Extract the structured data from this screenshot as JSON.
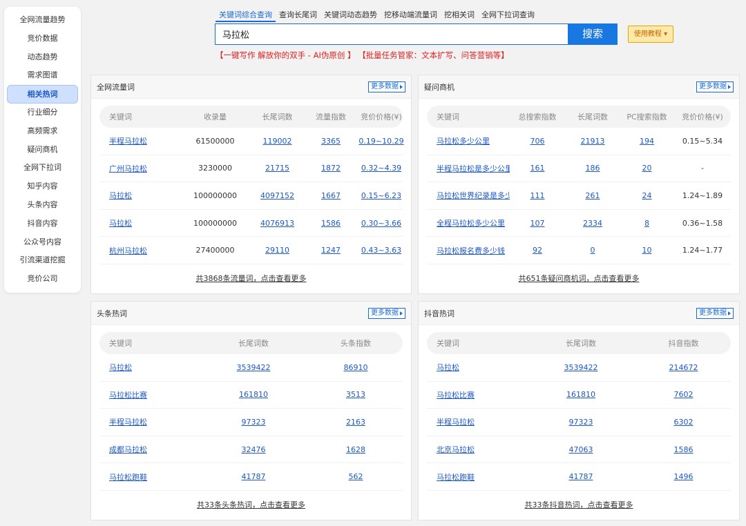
{
  "sidebar": {
    "items": [
      {
        "label": "全网流量趋势"
      },
      {
        "label": "竞价数据"
      },
      {
        "label": "动态趋势"
      },
      {
        "label": "需求图谱"
      },
      {
        "label": "相关热词"
      },
      {
        "label": "行业细分"
      },
      {
        "label": "高频需求"
      },
      {
        "label": "疑问商机"
      },
      {
        "label": "全网下拉词"
      },
      {
        "label": "知乎内容"
      },
      {
        "label": "头条内容"
      },
      {
        "label": "抖音内容"
      },
      {
        "label": "公众号内容"
      },
      {
        "label": "引流渠道挖掘"
      },
      {
        "label": "竞价公司"
      }
    ],
    "active_item": "相关热词"
  },
  "search": {
    "tabs": [
      "关键词综合查询",
      "查询长尾词",
      "关键词动态趋势",
      "挖移动端流量词",
      "挖相关词",
      "全网下拉词查询"
    ],
    "active_tab": "关键词综合查询",
    "value": "马拉松",
    "button_label": "搜索",
    "tutorial_label": "使用教程 ▾"
  },
  "promo": {
    "part1": "【一键写作 解放你的双手 - AI伪原创 】",
    "part2": "【批量任务管家：文本扩写、问答营销等】"
  },
  "panels": {
    "traffic": {
      "title": "全网流量词",
      "more_label": "更多数据",
      "headers": [
        "关键词",
        "收录量",
        "长尾词数",
        "流量指数",
        "竞价价格(¥)"
      ],
      "rows": [
        [
          "半程马拉松",
          "61500000",
          "119002",
          "3365",
          "0.19~10.29"
        ],
        [
          "广州马拉松",
          "3230000",
          "21715",
          "1872",
          "0.32~4.39"
        ],
        [
          "马拉松",
          "100000000",
          "4097152",
          "1667",
          "0.15~6.23"
        ],
        [
          "马拉松",
          "100000000",
          "4076913",
          "1586",
          "0.30~3.66"
        ],
        [
          "杭州马拉松",
          "27400000",
          "29110",
          "1247",
          "0.43~3.63"
        ]
      ],
      "footer": "共3868条流量词，点击查看更多"
    },
    "question": {
      "title": "疑问商机",
      "more_label": "更多数据",
      "headers": [
        "关键词",
        "总搜索指数",
        "长尾词数",
        "PC搜索指数",
        "竞价价格(¥)"
      ],
      "rows": [
        [
          "马拉松多少公里",
          "706",
          "21913",
          "194",
          "0.15~5.34"
        ],
        [
          "半程马拉松是多少公里",
          "161",
          "186",
          "20",
          "-"
        ],
        [
          "马拉松世界纪录是多少",
          "111",
          "261",
          "24",
          "1.24~1.89"
        ],
        [
          "全程马拉松多少公里",
          "107",
          "2334",
          "8",
          "0.36~1.58"
        ],
        [
          "马拉松报名费多少钱",
          "92",
          "0",
          "10",
          "1.24~1.77"
        ]
      ],
      "footer": "共651条疑问商机词，点击查看更多"
    },
    "toutiao": {
      "title": "头条热词",
      "more_label": "更多数据",
      "headers": [
        "关键词",
        "长尾词数",
        "头条指数"
      ],
      "rows": [
        [
          "马拉松",
          "3539422",
          "86910"
        ],
        [
          "马拉松比赛",
          "161810",
          "3513"
        ],
        [
          "半程马拉松",
          "97323",
          "2163"
        ],
        [
          "成都马拉松",
          "32476",
          "1628"
        ],
        [
          "马拉松跑鞋",
          "41787",
          "562"
        ]
      ],
      "footer": "共33条头条热词，点击查看更多"
    },
    "douyin": {
      "title": "抖音热词",
      "more_label": "更多数据",
      "headers": [
        "关键词",
        "长尾词数",
        "抖音指数"
      ],
      "rows": [
        [
          "马拉松",
          "3539422",
          "214672"
        ],
        [
          "马拉松比赛",
          "161810",
          "7602"
        ],
        [
          "半程马拉松",
          "97323",
          "6302"
        ],
        [
          "北京马拉松",
          "47063",
          "1586"
        ],
        [
          "马拉松跑鞋",
          "41787",
          "1496"
        ]
      ],
      "footer": "共33条抖音热词，点击查看更多"
    }
  }
}
